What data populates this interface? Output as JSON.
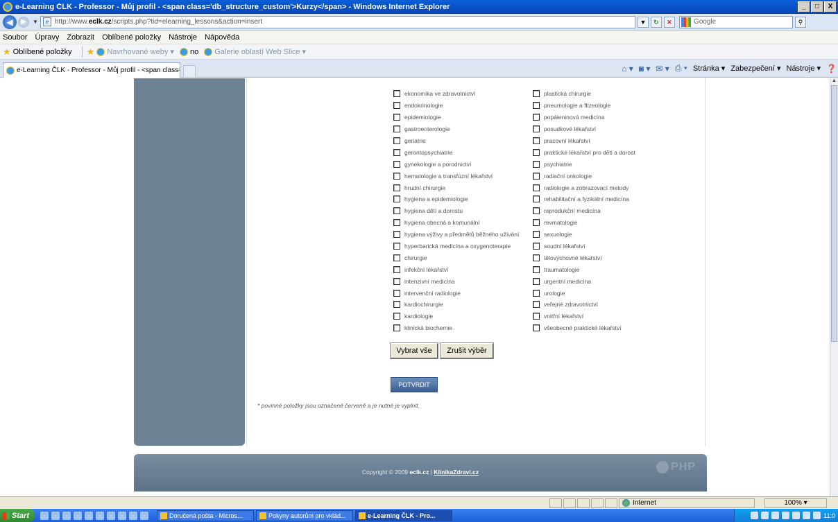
{
  "window": {
    "title": "e-Learning ČLK - Professor - Můj profil - <span class='db_structure_custom'>Kurzy</span> - Windows Internet Explorer",
    "minimize": "_",
    "maximize": "□",
    "close": "X"
  },
  "address": {
    "prefix": "http://www.",
    "domain": "eclk.cz",
    "path": "/scripts.php?tid=elearning_lessons&action=insert",
    "search_placeholder": "Google"
  },
  "menu": [
    "Soubor",
    "Úpravy",
    "Zobrazit",
    "Oblíbené položky",
    "Nástroje",
    "Nápověda"
  ],
  "favorites": {
    "label": "Oblíbené položky",
    "items": [
      "Navrhované weby ▾",
      "no",
      "Galerie oblastí Web Slice ▾"
    ]
  },
  "tab": {
    "title": "e-Learning ČLK - Professor - Můj profil - <span class='db..."
  },
  "command_bar": {
    "page": "Stránka ▾",
    "security": "Zabezpečení ▾",
    "tools": "Nástroje ▾"
  },
  "checkboxes": {
    "col1": [
      "ekonomika ve zdravotnictví",
      "endokrinologie",
      "epidemiologie",
      "gastroenterologie",
      "geriatrie",
      "gerontopsychiatrie",
      "gynekologie a porodnictví",
      "hematologie a transfúzní lékařství",
      "hrudní chirurgie",
      "hygiena a epidemiologie",
      "hygiena dětí a dorostu",
      "hygiena obecná a komunální",
      "hygiena výživy a předmětů běžného užívání",
      "hyperbarická medicína a oxygenoterapie",
      "chirurgie",
      "infekční lékařství",
      "intenzivní medicína",
      "intervenční radiologie",
      "kardiochirurgie",
      "kardiologie",
      "klinická biochemie"
    ],
    "col2": [
      "plastická chirurgie",
      "pneumologie a ftizeologie",
      "popáleninová medicína",
      "posudkové lékařství",
      "pracovní lékařství",
      "praktické lékařství pro děti a dorost",
      "psychiatrie",
      "radiační onkologie",
      "radiologie a zobrazovací metody",
      "rehabilitační a fyzikální medicína",
      "reprodukční medicína",
      "revmatologie",
      "sexuologie",
      "soudní lékařství",
      "tělovýchovné lékařství",
      "traumatologie",
      "urgentní medicína",
      "urologie",
      "veřejné zdravotnictví",
      "vnitřní lékařství",
      "všeobecné praktické lékařství"
    ]
  },
  "buttons": {
    "select_all": "Vybrat vše",
    "clear_selection": "Zrušit výběr",
    "confirm": "POTVRDIT"
  },
  "note": "* povinné položky jsou označené červeně a je nutné je vyplnit.",
  "footer": {
    "copyright": "Copyright © 2009",
    "site": "eclk.cz",
    "separator": "|",
    "link": "KlinikaZdravi.cz",
    "logo_text": "PHP"
  },
  "status": {
    "zone": "Internet",
    "zoom": "100% ▾"
  },
  "taskbar": {
    "start": "Start",
    "items": [
      "Doručená pošta - Micros...",
      "Pokyny autorům pro vklád...",
      "e-Learning ČLK - Pro..."
    ],
    "clock": "11:0"
  }
}
